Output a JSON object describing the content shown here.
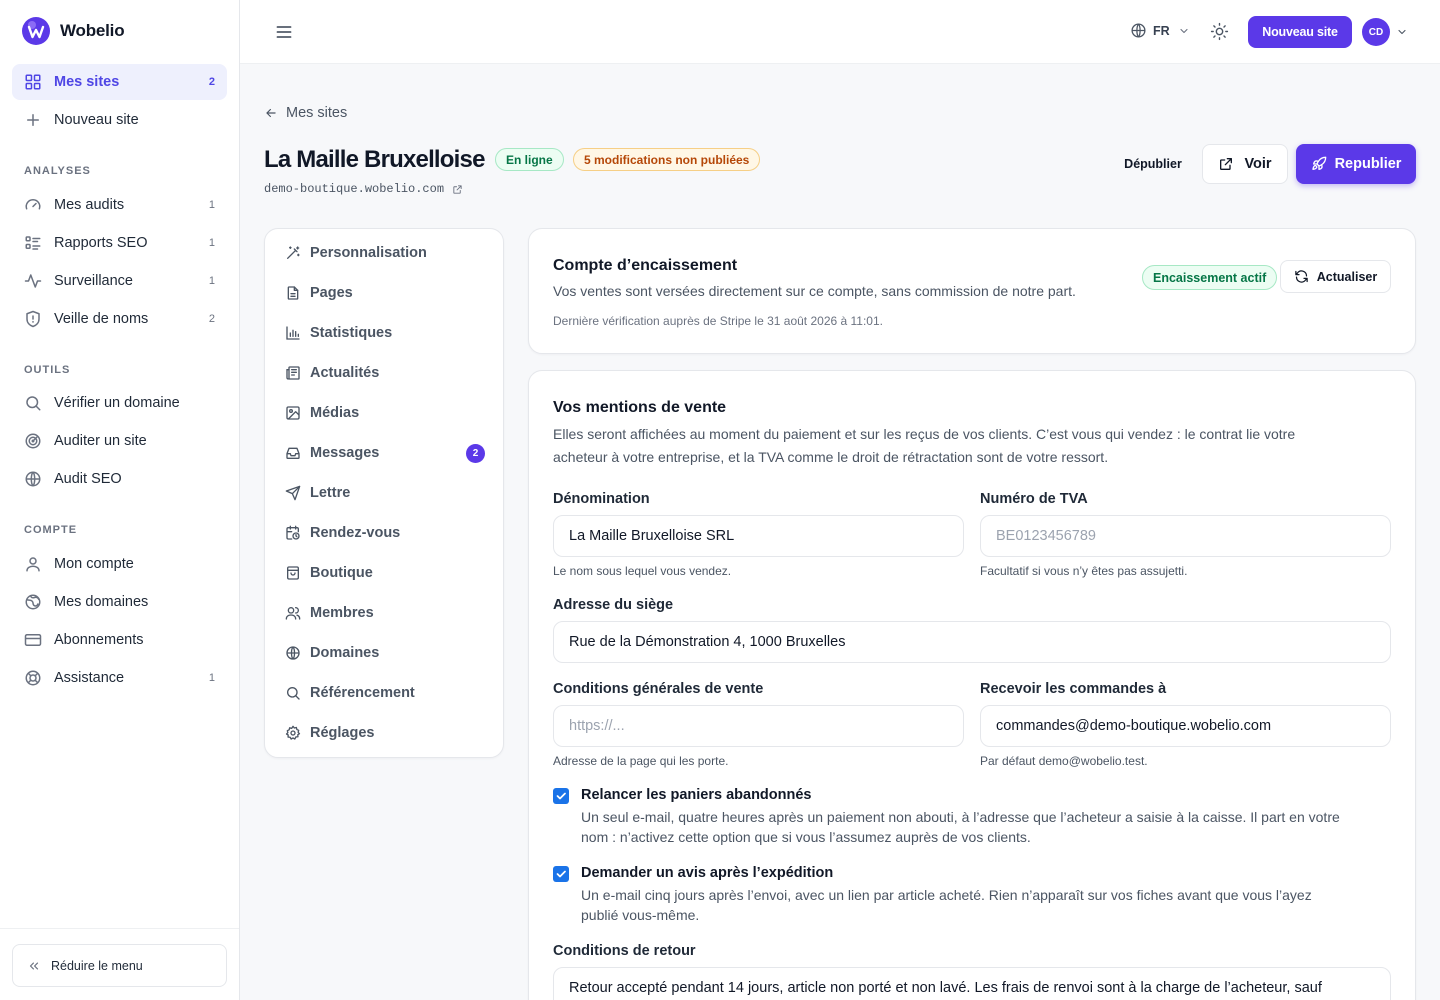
{
  "brand": {
    "name": "Wobelio"
  },
  "sidebar": {
    "main": [
      {
        "label": "Mes sites",
        "count": "2"
      },
      {
        "label": "Nouveau site",
        "count": ""
      }
    ],
    "sections": [
      {
        "title": "ANALYSES",
        "items": [
          {
            "label": "Mes audits",
            "count": "1"
          },
          {
            "label": "Rapports SEO",
            "count": "1"
          },
          {
            "label": "Surveillance",
            "count": "1"
          },
          {
            "label": "Veille de noms",
            "count": "2"
          }
        ]
      },
      {
        "title": "OUTILS",
        "items": [
          {
            "label": "Vérifier un domaine",
            "count": ""
          },
          {
            "label": "Auditer un site",
            "count": ""
          },
          {
            "label": "Audit SEO",
            "count": ""
          }
        ]
      },
      {
        "title": "COMPTE",
        "items": [
          {
            "label": "Mon compte",
            "count": ""
          },
          {
            "label": "Mes domaines",
            "count": ""
          },
          {
            "label": "Abonnements",
            "count": ""
          },
          {
            "label": "Assistance",
            "count": "1"
          }
        ]
      }
    ],
    "collapse_label": "Réduire le menu"
  },
  "topbar": {
    "language": "FR",
    "new_site_label": "Nouveau site",
    "avatar_initials": "CD",
    "accent_color": "#5b39e8"
  },
  "header": {
    "back_label": "Mes sites",
    "title": "La Maille Bruxelloise",
    "status_badge": "En ligne",
    "changes_badge": "5 modifications non publiées",
    "domain": "demo-boutique.wobelio.com",
    "unpublish_label": "Dépublier",
    "view_label": "Voir",
    "republish_label": "Republier"
  },
  "subnav": {
    "items": [
      {
        "label": "Personnalisation",
        "icon": "wand-icon",
        "badge": ""
      },
      {
        "label": "Pages",
        "icon": "file-icon",
        "badge": ""
      },
      {
        "label": "Statistiques",
        "icon": "bar-chart-icon",
        "badge": ""
      },
      {
        "label": "Actualités",
        "icon": "newspaper-icon",
        "badge": ""
      },
      {
        "label": "Médias",
        "icon": "image-icon",
        "badge": ""
      },
      {
        "label": "Messages",
        "icon": "inbox-icon",
        "badge": "2"
      },
      {
        "label": "Lettre",
        "icon": "send-icon",
        "badge": ""
      },
      {
        "label": "Rendez-vous",
        "icon": "calendar-clock-icon",
        "badge": ""
      },
      {
        "label": "Boutique",
        "icon": "shopping-bag-icon",
        "badge": ""
      },
      {
        "label": "Membres",
        "icon": "users-icon",
        "badge": ""
      },
      {
        "label": "Domaines",
        "icon": "globe-icon",
        "badge": ""
      },
      {
        "label": "Référencement",
        "icon": "search-icon",
        "badge": ""
      },
      {
        "label": "Réglages",
        "icon": "gear-icon",
        "badge": ""
      }
    ]
  },
  "payment_card": {
    "title": "Compte d’encaissement",
    "description": "Vos ventes sont versées directement sur ce compte, sans commission de notre part.",
    "last_check": "Dernière vérification auprès de Stripe le 31 août 2026 à 11:01.",
    "status_badge": "Encaissement actif",
    "refresh_label": "Actualiser"
  },
  "legal_card": {
    "title": "Vos mentions de vente",
    "description_line1": "Elles seront affichées au moment du paiement et sur les reçus de vos clients. C’est vous qui vendez : le contrat lie votre",
    "description_line2": "acheteur à votre entreprise, et la TVA comme le droit de rétractation sont de votre ressort.",
    "fields": {
      "company": {
        "label": "Dénomination",
        "value": "La Maille Bruxelloise SRL",
        "help": "Le nom sous lequel vous vendez."
      },
      "vat": {
        "label": "Numéro de TVA",
        "value": "",
        "placeholder": "BE0123456789",
        "help": "Facultatif si vous n’y êtes pas assujetti."
      },
      "address": {
        "label": "Adresse du siège",
        "value": "Rue de la Démonstration 4, 1000 Bruxelles"
      },
      "terms": {
        "label": "Conditions générales de vente",
        "value": "",
        "placeholder": "https://...",
        "help": "Adresse de la page qui les porte."
      },
      "orders_email": {
        "label": "Recevoir les commandes à",
        "value": "commandes@demo-boutique.wobelio.com",
        "help": "Par défaut demo@wobelio.test."
      }
    },
    "options": [
      {
        "label": "Relancer les paniers abandonnés",
        "checked": true,
        "desc_line1": "Un seul e-mail, quatre heures après un paiement non abouti, à l’adresse que l’acheteur a saisie à la caisse. Il part en votre",
        "desc_line2": "nom : n’activez cette option que si vous l’assumez auprès de vos clients."
      },
      {
        "label": "Demander un avis après l’expédition",
        "checked": true,
        "desc_line1": "Un e-mail cinq jours après l’envoi, avec un lien par article acheté. Rien n’apparaît sur vos fiches avant que vous l’ayez",
        "desc_line2": "publié vous-même."
      }
    ],
    "returns": {
      "label": "Conditions de retour",
      "value": "Retour accepté pendant 14 jours, article non porté et non lavé. Les frais de renvoi sont à la charge de l’acheteur, sauf"
    }
  }
}
